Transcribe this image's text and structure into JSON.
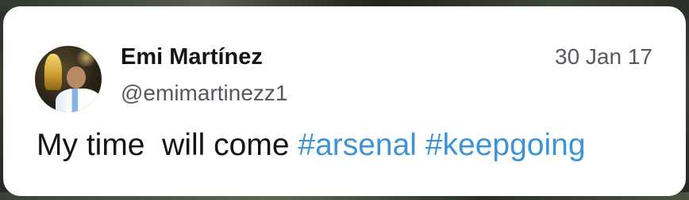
{
  "tweet": {
    "display_name": "Emi Martínez",
    "handle": "@emimartinezz1",
    "date": "30 Jan 17",
    "text": "My time  will come ",
    "hashtags": [
      "#arsenal",
      "#keepgoing"
    ],
    "avatar_icon": "profile-photo",
    "colors": {
      "hashtag": "#3b94d9",
      "name": "#141414",
      "meta": "#55595e",
      "card": "#ffffff"
    }
  }
}
